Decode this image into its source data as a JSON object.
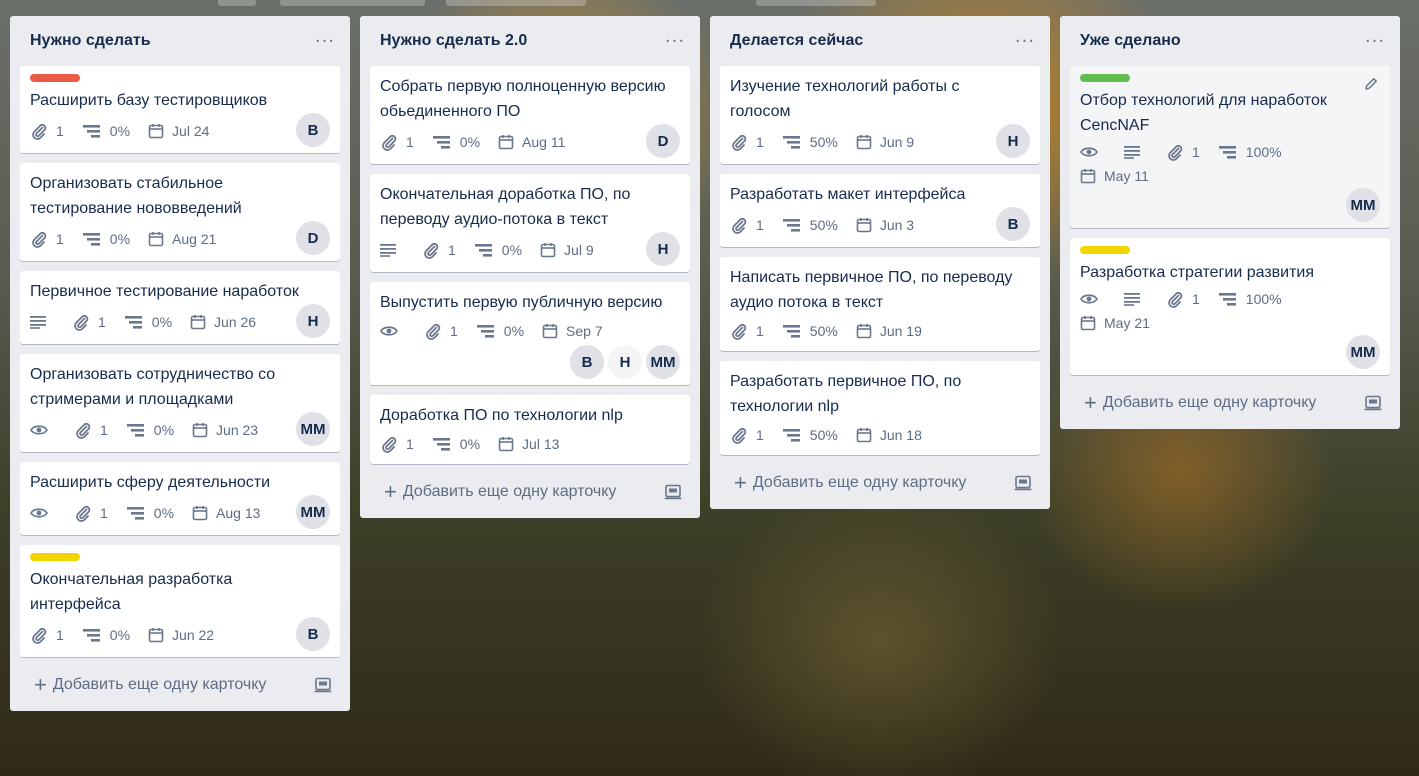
{
  "colors": {
    "red": "#eb5a46",
    "yellow": "#f2d600",
    "green": "#61bd4f"
  },
  "add_card_label": "Добавить еще одну карточку",
  "lists": [
    {
      "title": "Нужно сделать",
      "cards": [
        {
          "label": "red",
          "title": "Расширить базу тестировщиков",
          "attachments": "1",
          "checklist": "0%",
          "due": "Jul 24",
          "members": [
            "B"
          ]
        },
        {
          "title": "Организовать стабильное тестирование нововведений",
          "attachments": "1",
          "checklist": "0%",
          "due": "Aug 21",
          "members": [
            "D"
          ]
        },
        {
          "title": "Первичное тестирование наработок",
          "description": true,
          "attachments": "1",
          "checklist": "0%",
          "due": "Jun 26",
          "members": [
            "H"
          ]
        },
        {
          "title": "Организовать сотрудничество со стримерами и площадками",
          "watch": true,
          "attachments": "1",
          "checklist": "0%",
          "due": "Jun 23",
          "members": [
            "MM"
          ]
        },
        {
          "title": "Расширить сферу деятельности",
          "watch": true,
          "attachments": "1",
          "checklist": "0%",
          "due": "Aug 13",
          "members": [
            "MM"
          ]
        },
        {
          "label": "yellow",
          "title": "Окончательная разработка интерфейса",
          "attachments": "1",
          "checklist": "0%",
          "due": "Jun 22",
          "members": [
            "B"
          ]
        }
      ]
    },
    {
      "title": "Нужно сделать 2.0",
      "cards": [
        {
          "title": "Собрать первую полноценную версию  обьединенного ПО",
          "attachments": "1",
          "checklist": "0%",
          "due": "Aug 11",
          "members": [
            "D"
          ]
        },
        {
          "title": "Окончательная доработка ПО, по переводу аудио-потока в текст",
          "description": true,
          "attachments": "1",
          "checklist": "0%",
          "due": "Jul 9",
          "members": [
            "H"
          ]
        },
        {
          "title": "Выпустить первую публичную версию",
          "watch": true,
          "attachments": "1",
          "checklist": "0%",
          "due": "Sep 7",
          "members": [
            "B",
            "H",
            "MM"
          ],
          "members_separate": true
        },
        {
          "title": "Доработка ПО по технологии nlp",
          "attachments": "1",
          "checklist": "0%",
          "due": "Jul 13",
          "members": []
        }
      ]
    },
    {
      "title": "Делается сейчас",
      "cards": [
        {
          "title": "Изучение технологий работы с голосом",
          "attachments": "1",
          "checklist": "50%",
          "due": "Jun 9",
          "members": [
            "H"
          ]
        },
        {
          "title": "Разработать макет интерфейса",
          "attachments": "1",
          "checklist": "50%",
          "due": "Jun 3",
          "members": [
            "B"
          ]
        },
        {
          "title": "Написать первичное ПО, по переводу аудио потока в текст",
          "attachments": "1",
          "checklist": "50%",
          "due": "Jun 19",
          "members": []
        },
        {
          "title": "Разработать первичное ПО, по технологии nlp",
          "attachments": "1",
          "checklist": "50%",
          "due": "Jun 18",
          "members": []
        }
      ]
    },
    {
      "title": "Уже сделано",
      "cards": [
        {
          "label": "green",
          "title": "Отбор технологий для наработок CencNAF",
          "watch": true,
          "description": true,
          "attachments": "1",
          "checklist": "100%",
          "due": "May 11",
          "members": [
            "MM"
          ],
          "members_separate": true,
          "hovered": true
        },
        {
          "label": "yellow",
          "title": "Разработка стратегии развития",
          "watch": true,
          "description": true,
          "attachments": "1",
          "checklist": "100%",
          "due": "May 21",
          "members": [
            "MM"
          ],
          "members_separate": true
        }
      ]
    }
  ]
}
